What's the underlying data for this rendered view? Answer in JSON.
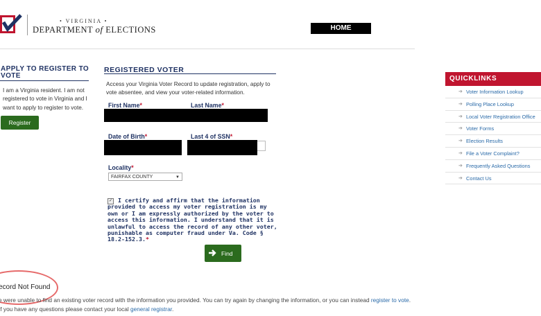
{
  "header": {
    "org_small": "• VIRGINIA •",
    "org_main_pre": "DEPARTMENT ",
    "org_main_of": "of",
    "org_main_post": " ELECTIONS",
    "home_label": "HOME"
  },
  "apply": {
    "heading": "APPLY TO REGISTER TO VOTE",
    "text": "I am a Virginia resident. I am not registered to vote in Virginia and I want to apply to register to vote.",
    "button": "Register"
  },
  "form": {
    "heading": "REGISTERED VOTER",
    "description": "Access your Virginia Voter Record to update registration, apply to vote absentee, and view your voter-related information.",
    "first_name_label": "First Name",
    "last_name_label": "Last Name",
    "dob_label": "Date of Birth",
    "ssn_label": "Last 4 of SSN",
    "locality_label": "Locality",
    "required_mark": "*",
    "locality_value": "FAIRFAX COUNTY",
    "certify_text": "I certify and affirm that the information provided to access my voter registration is my own or I am expressly authorized by the voter to access this information. I understand that it is unlawful to access the record of any other voter, punishable as computer fraud under Va. Code § 18.2-152.3.",
    "certify_checked": true,
    "find_button": "Find"
  },
  "result": {
    "title": "ecord Not Found",
    "text_pre": "e were unable to find an existing voter record with the information you provided. You can try again by changing the information, or you can instead ",
    "link1": "register to vote",
    "text_mid": ". If you have any questions please contact your local ",
    "link2": "general registrar",
    "text_end": "."
  },
  "quicklinks": {
    "heading": "QUICKLINKS",
    "items": [
      "Voter Information Lookup",
      "Polling Place Lookup",
      "Local Voter Registration Office",
      "Voter Forms",
      "Election Results",
      "File a Voter Complaint?",
      "Frequently Asked Questions",
      "Contact Us"
    ]
  },
  "colors": {
    "navy": "#1f3263",
    "red": "#c0152f",
    "green": "#2b6b1e",
    "link": "#2a6aa8",
    "annotation": "#e66a6a"
  }
}
